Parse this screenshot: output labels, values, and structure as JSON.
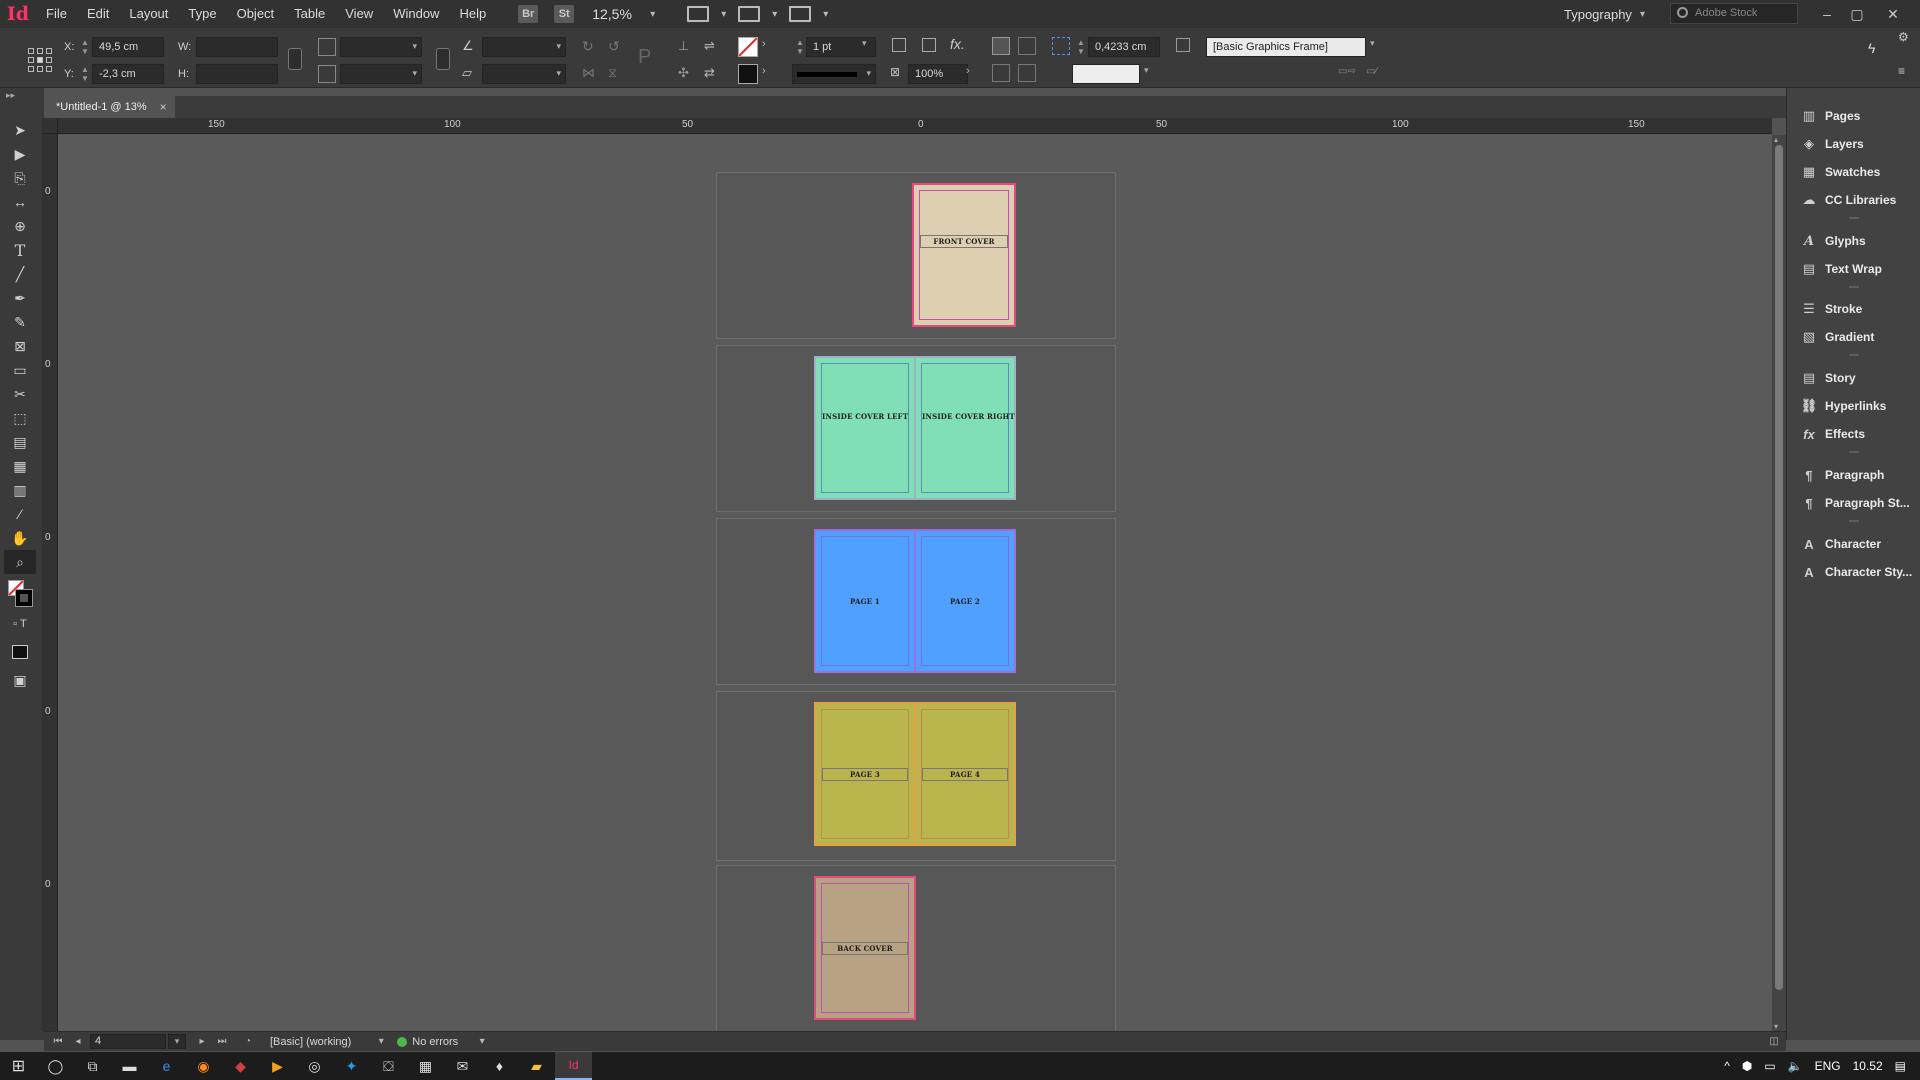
{
  "app": {
    "logo": "Id",
    "menu": [
      "File",
      "Edit",
      "Layout",
      "Type",
      "Object",
      "Table",
      "View",
      "Window",
      "Help"
    ],
    "bridge": "Br",
    "stock": "St",
    "zoom": "12,5%",
    "workspace": "Typography",
    "search_placeholder": "Adobe Stock"
  },
  "control": {
    "x_label": "X:",
    "x_value": "49,5 cm",
    "y_label": "Y:",
    "y_value": "-2,3 cm",
    "w_label": "W:",
    "h_label": "H:",
    "stroke_weight": "1 pt",
    "opacity": "100%",
    "offset": "0,4233 cm",
    "object_style": "[Basic Graphics Frame]"
  },
  "tab": {
    "title": "*Untitled-1 @ 13%",
    "close": "×"
  },
  "ruler": {
    "h_labels": [
      "150",
      "100",
      "50",
      "0",
      "50",
      "100",
      "150"
    ],
    "v_labels": [
      "0",
      "0",
      "0",
      "0",
      "0"
    ]
  },
  "spreads": [
    {
      "pages": [
        {
          "label": "FRONT COVER",
          "fill": "#ddcfaf",
          "border": "#e8477e",
          "margin": "#c74ab9"
        }
      ]
    },
    {
      "pages": [
        {
          "label": "INSIDE COVER LEFT",
          "fill": "#80dfb5",
          "border": "#9fb0c8",
          "margin": "#5f8cc0"
        },
        {
          "label": "INSIDE COVER RIGHT",
          "fill": "#80dfb5",
          "border": "#9fb0c8",
          "margin": "#5f8cc0"
        }
      ]
    },
    {
      "pages": [
        {
          "label": "PAGE 1",
          "fill": "#50a0ff",
          "border": "#a06ee0",
          "margin": "#7f6fd8"
        },
        {
          "label": "PAGE 2",
          "fill": "#50a0ff",
          "border": "#a06ee0",
          "margin": "#7f6fd8"
        }
      ]
    },
    {
      "pages": [
        {
          "label": "PAGE 3",
          "fill": "#b9b44c",
          "border": "#e8a040",
          "margin": "#c08a55"
        },
        {
          "label": "PAGE 4",
          "fill": "#b9b44c",
          "border": "#e8a040",
          "margin": "#c08a55"
        }
      ]
    },
    {
      "pages": [
        {
          "label": "BACK COVER",
          "fill": "#b7a384",
          "border": "#e8477e",
          "margin": "#c74ab9"
        }
      ]
    }
  ],
  "status": {
    "page": "4",
    "preflight_profile": "[Basic] (working)",
    "errors": "No errors"
  },
  "panels": [
    {
      "label": "Pages",
      "icon": "pages-icon"
    },
    {
      "label": "Layers",
      "icon": "layers-icon"
    },
    {
      "label": "Swatches",
      "icon": "swatches-icon"
    },
    {
      "label": "CC Libraries",
      "icon": "cc-libraries-icon"
    },
    {
      "label": "Glyphs",
      "icon": "glyphs-icon"
    },
    {
      "label": "Text Wrap",
      "icon": "text-wrap-icon"
    },
    {
      "label": "Stroke",
      "icon": "stroke-icon"
    },
    {
      "label": "Gradient",
      "icon": "gradient-icon"
    },
    {
      "label": "Story",
      "icon": "story-icon"
    },
    {
      "label": "Hyperlinks",
      "icon": "hyperlinks-icon"
    },
    {
      "label": "Effects",
      "icon": "effects-icon"
    },
    {
      "label": "Paragraph",
      "icon": "paragraph-icon"
    },
    {
      "label": "Paragraph St...",
      "icon": "paragraph-styles-icon"
    },
    {
      "label": "Character",
      "icon": "character-icon"
    },
    {
      "label": "Character Sty...",
      "icon": "character-styles-icon"
    }
  ],
  "taskbar": {
    "language": "ENG",
    "time": "10.52"
  }
}
